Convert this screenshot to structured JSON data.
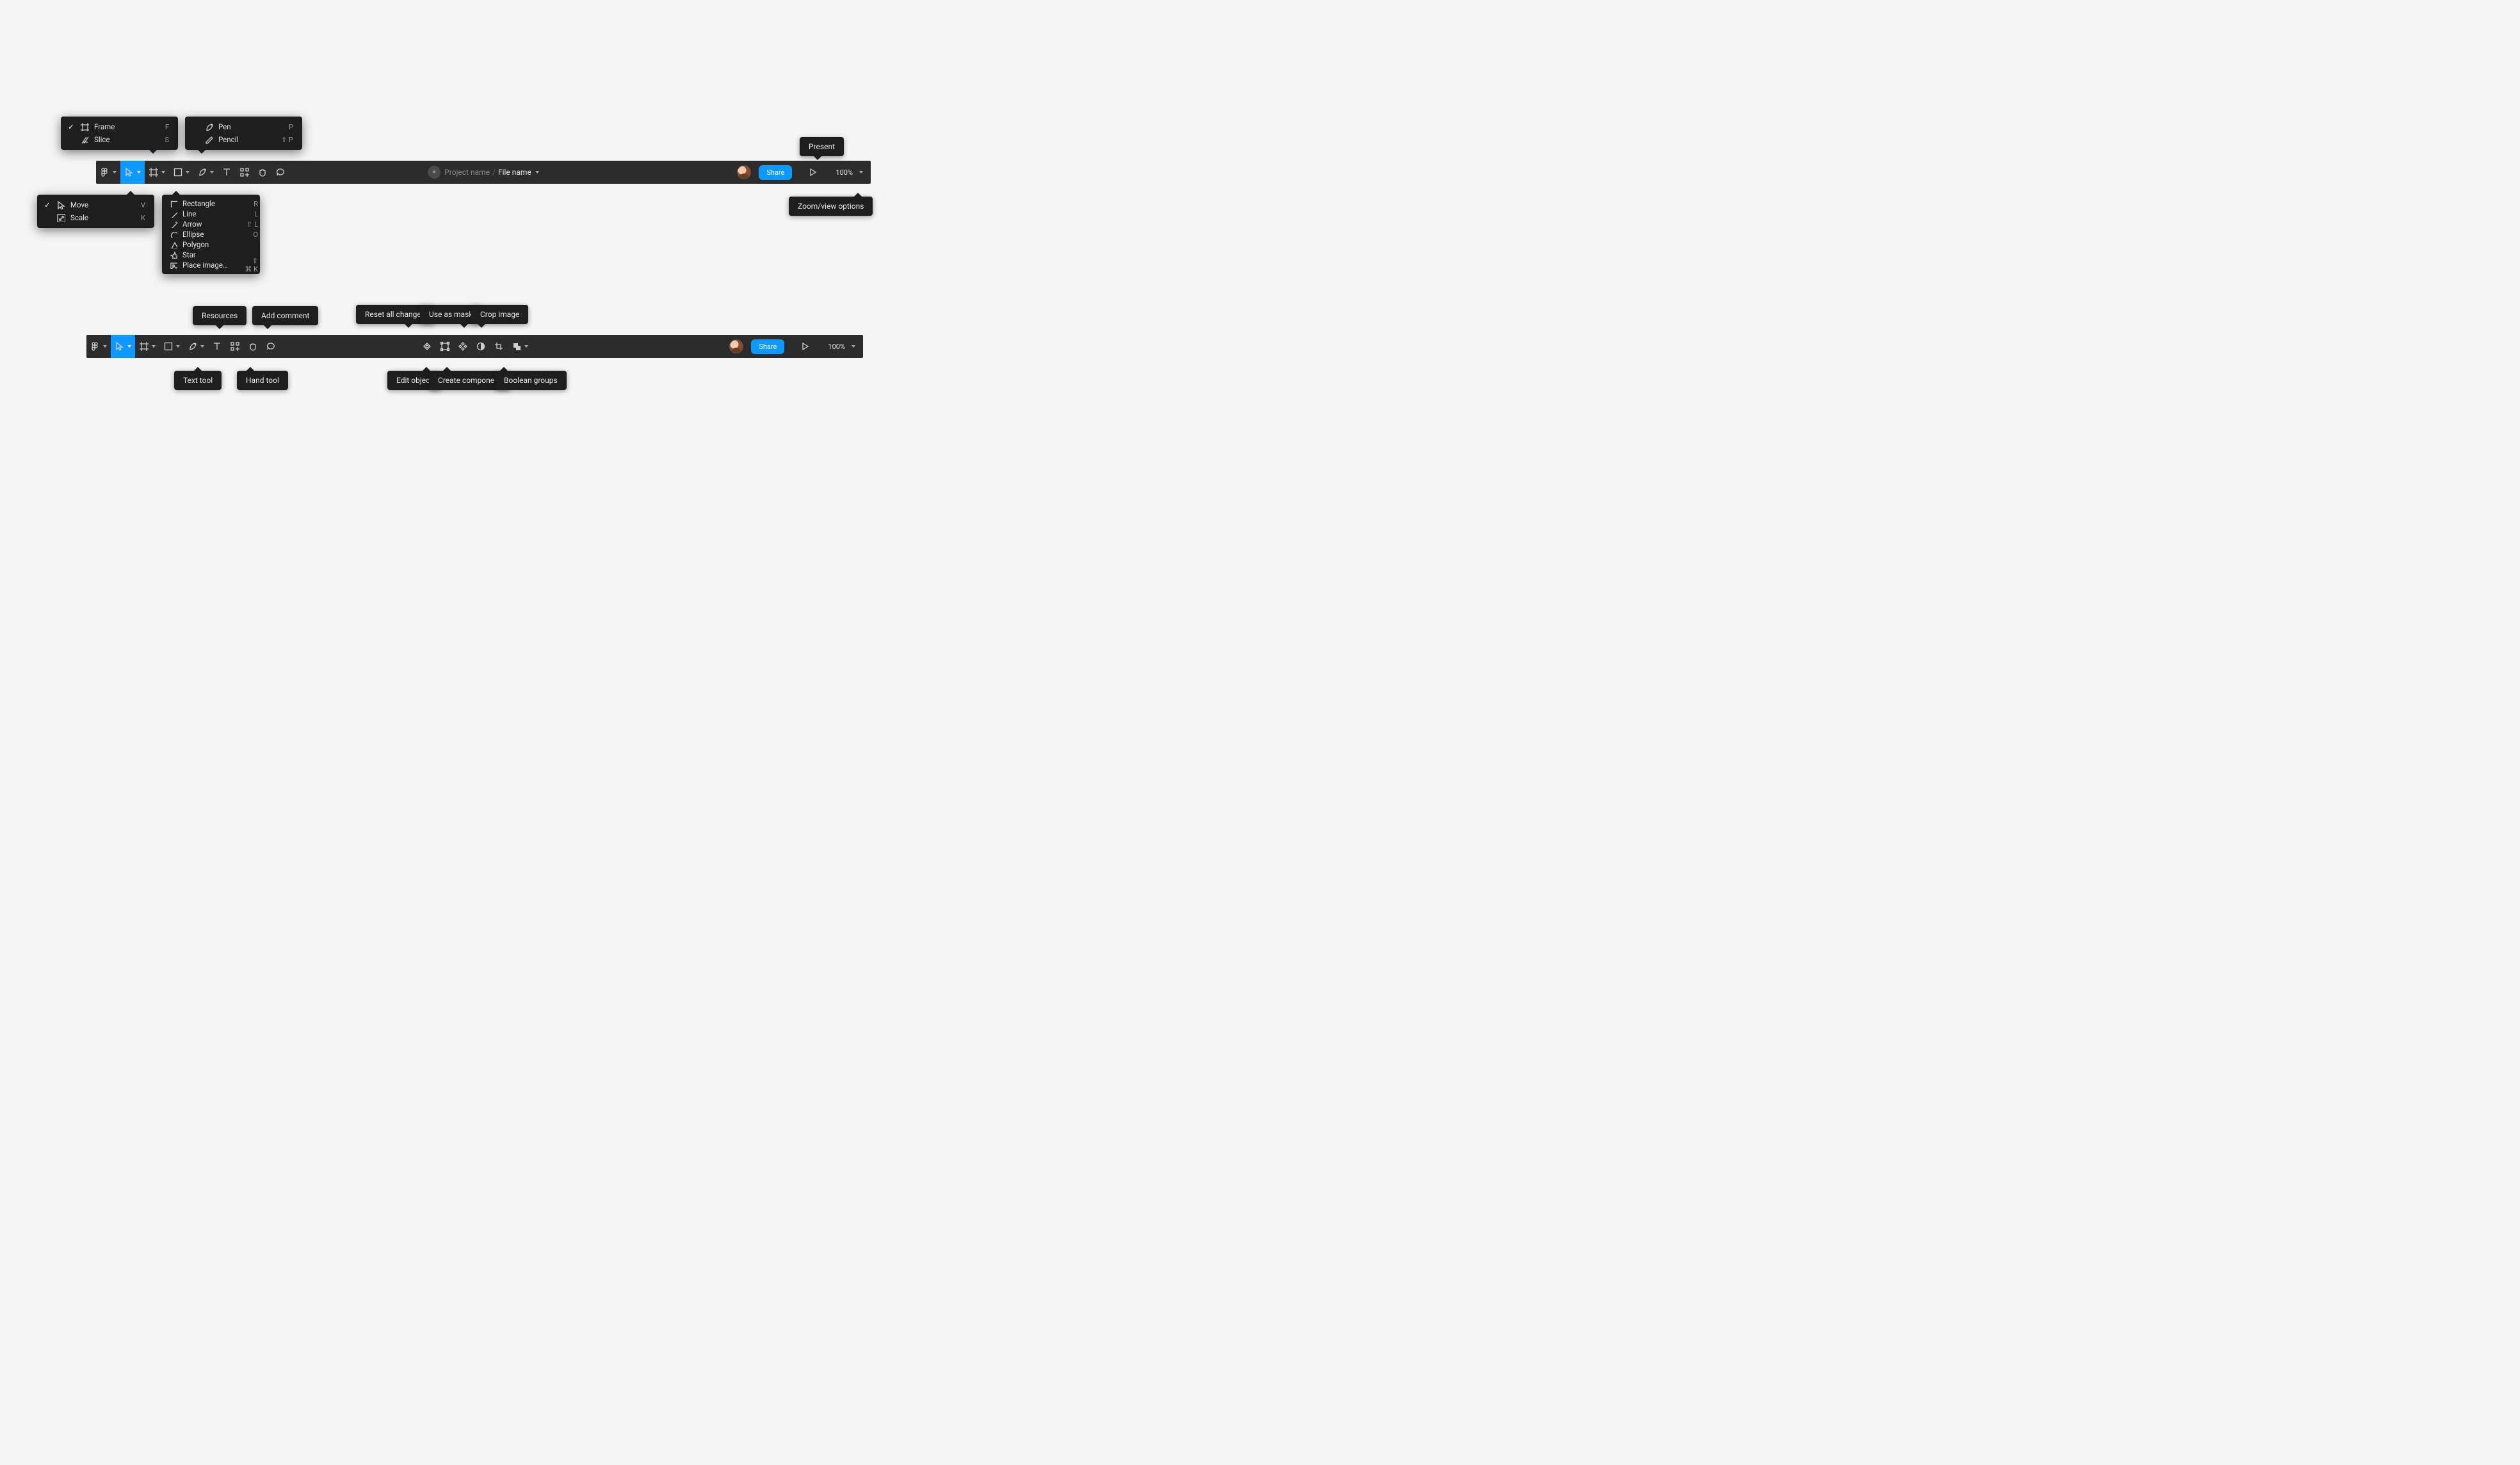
{
  "colors": {
    "accent": "#0d99ff",
    "bar": "#2c2c2c",
    "tip": "#1e1e1e"
  },
  "toolbar1": {
    "project_name": "Project name",
    "file_name": "File name",
    "share_label": "Share",
    "zoom_label": "100%"
  },
  "toolbar2": {
    "share_label": "Share",
    "zoom_label": "100%"
  },
  "tooltips": {
    "present": "Present",
    "zoom_view": "Zoom/view options",
    "resources": "Resources",
    "add_comment": "Add comment",
    "reset_changes": "Reset all changes",
    "use_as_mask": "Use as mask",
    "crop_image": "Crop image",
    "text_tool": "Text tool",
    "hand_tool": "Hand tool",
    "edit_object": "Edit object",
    "create_component": "Create component",
    "boolean_groups": "Boolean groups"
  },
  "menus": {
    "move": {
      "items": [
        {
          "checked": true,
          "icon": "cursor",
          "label": "Move",
          "shortcut": "V"
        },
        {
          "checked": false,
          "icon": "scale",
          "label": "Scale",
          "shortcut": "K"
        }
      ]
    },
    "frame": {
      "items": [
        {
          "checked": true,
          "icon": "frame",
          "label": "Frame",
          "shortcut": "F"
        },
        {
          "checked": false,
          "icon": "slice",
          "label": "Slice",
          "shortcut": "S"
        }
      ]
    },
    "shape": {
      "items": [
        {
          "icon": "rect",
          "label": "Rectangle",
          "shortcut": "R"
        },
        {
          "icon": "line",
          "label": "Line",
          "shortcut": "L"
        },
        {
          "icon": "arrow",
          "label": "Arrow",
          "shortcut": "⇧ L"
        },
        {
          "icon": "ellipse",
          "label": "Ellipse",
          "shortcut": "O"
        },
        {
          "icon": "polygon",
          "label": "Polygon",
          "shortcut": ""
        },
        {
          "icon": "star",
          "label": "Star",
          "shortcut": ""
        },
        {
          "icon": "image",
          "label": "Place image…",
          "shortcut": "⇧ ⌘ K"
        }
      ]
    },
    "pen": {
      "items": [
        {
          "icon": "pen",
          "label": "Pen",
          "shortcut": "P"
        },
        {
          "icon": "pencil",
          "label": "Pencil",
          "shortcut": "⇧ P"
        }
      ]
    }
  }
}
